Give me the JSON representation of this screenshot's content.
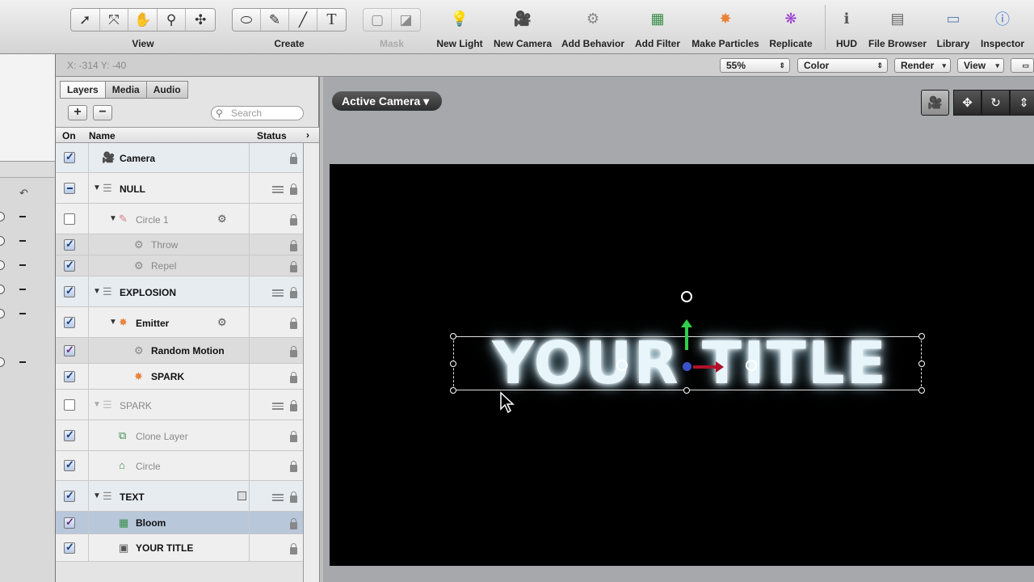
{
  "toolbar": {
    "view_label": "View",
    "create_label": "Create",
    "mask_label": "Mask",
    "buttons": [
      {
        "label": "New Light",
        "icon": "lightbulb-icon"
      },
      {
        "label": "New Camera",
        "icon": "camera-icon"
      },
      {
        "label": "Add Behavior",
        "icon": "gear-icon"
      },
      {
        "label": "Add Filter",
        "icon": "filter-icon"
      },
      {
        "label": "Make Particles",
        "icon": "particles-icon"
      },
      {
        "label": "Replicate",
        "icon": "replicate-icon"
      },
      {
        "label": "HUD",
        "icon": "info-icon"
      },
      {
        "label": "File Browser",
        "icon": "file-browser-icon"
      },
      {
        "label": "Library",
        "icon": "library-icon"
      },
      {
        "label": "Inspector",
        "icon": "inspector-icon"
      }
    ]
  },
  "status": {
    "coords": "X: -314   Y: -40",
    "zoom": "55%",
    "channel": "Color",
    "render": "Render",
    "view": "View"
  },
  "panel": {
    "tabs": [
      "Layers",
      "Media",
      "Audio"
    ],
    "search_placeholder": "Search",
    "col_on": "On",
    "col_name": "Name",
    "col_status": "Status",
    "layers": [
      {
        "name": "Camera",
        "checked": true
      },
      {
        "name": "NULL",
        "checked": "mixed"
      },
      {
        "name": "Circle 1",
        "checked": false
      },
      {
        "name": "Throw",
        "checked": true
      },
      {
        "name": "Repel",
        "checked": true
      },
      {
        "name": "EXPLOSION",
        "checked": true
      },
      {
        "name": "Emitter",
        "checked": true
      },
      {
        "name": "Random Motion",
        "checked": true
      },
      {
        "name": "SPARK",
        "checked": true
      },
      {
        "name": "SPARK",
        "checked": false
      },
      {
        "name": "Clone Layer",
        "checked": true
      },
      {
        "name": "Circle",
        "checked": true
      },
      {
        "name": "TEXT",
        "checked": true
      },
      {
        "name": "Bloom",
        "checked": true
      },
      {
        "name": "YOUR TITLE",
        "checked": true
      }
    ]
  },
  "canvas": {
    "camera_menu": "Active Camera ▾",
    "title_text": "YOUR TITLE"
  },
  "colors": {
    "toolbar_bg": "#d9d9d9",
    "selected_row": "#b9c7db",
    "canvas_bg": "#000000",
    "y_axis": "#2fcf4a",
    "x_axis": "#b0122a",
    "center": "#3a52c9"
  }
}
